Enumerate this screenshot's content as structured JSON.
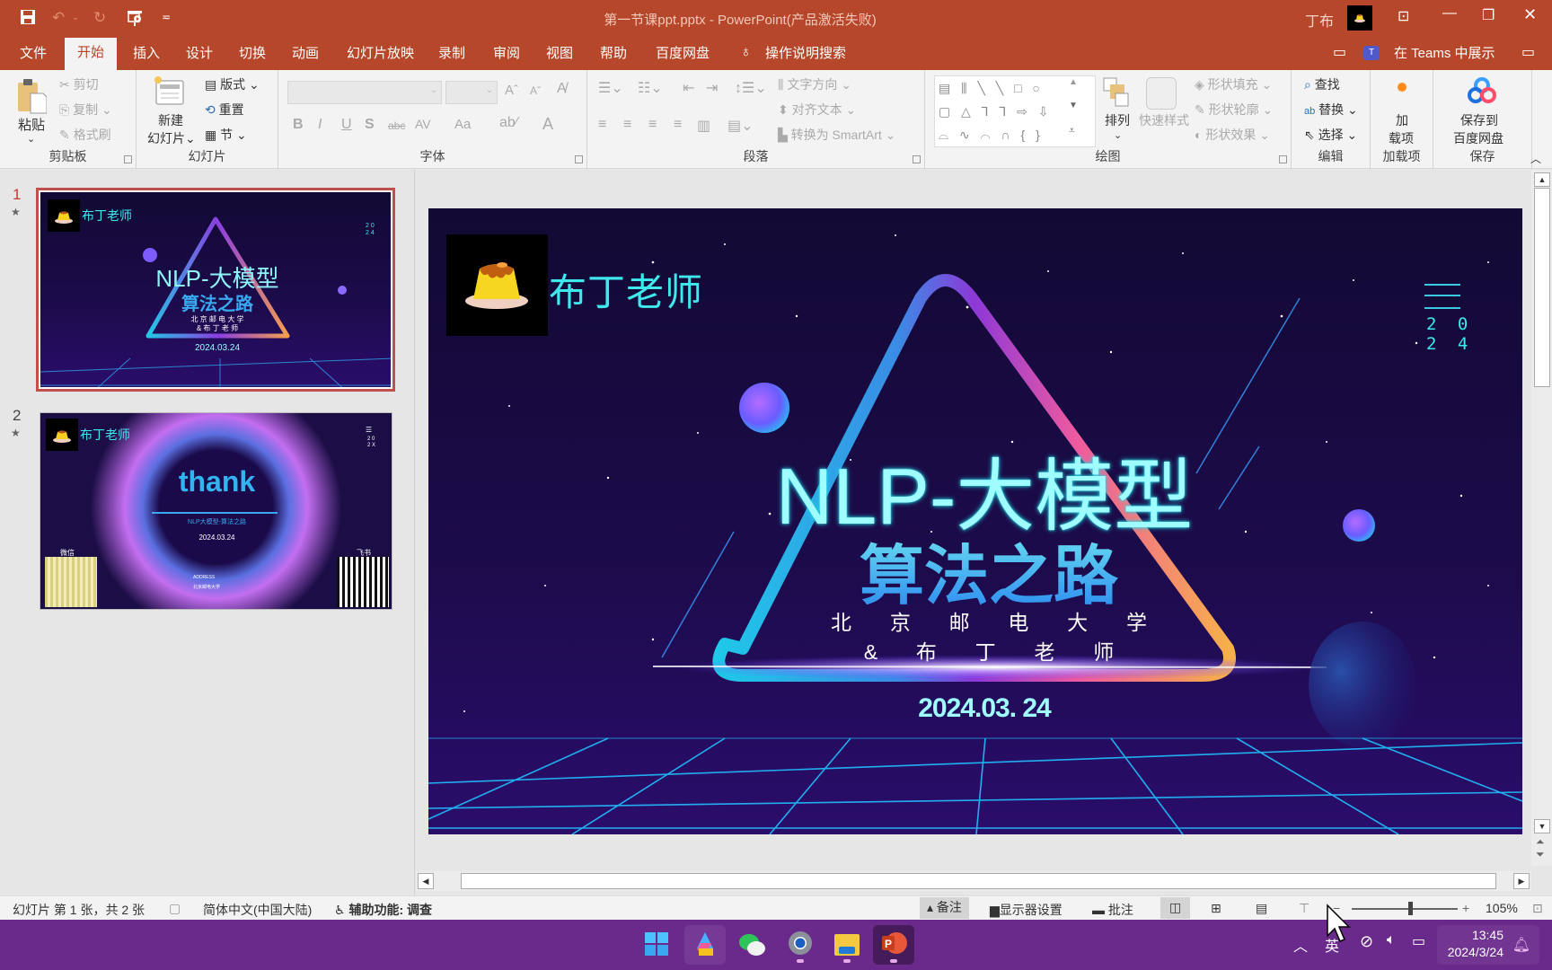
{
  "titlebar": {
    "doc_title": "第一节课ppt.pptx  -  PowerPoint(产品激活失败)",
    "user_name": "丁布",
    "quick_access": [
      "save-icon",
      "undo-icon",
      "redo-icon",
      "present-from-start-icon",
      "customize-qat-icon"
    ],
    "window_controls": [
      "ribbon-display-options",
      "minimize",
      "restore",
      "close"
    ]
  },
  "tabs": [
    {
      "label": "文件",
      "active": false
    },
    {
      "label": "开始",
      "active": true
    },
    {
      "label": "插入",
      "active": false
    },
    {
      "label": "设计",
      "active": false
    },
    {
      "label": "切换",
      "active": false
    },
    {
      "label": "动画",
      "active": false
    },
    {
      "label": "幻灯片放映",
      "active": false
    },
    {
      "label": "录制",
      "active": false
    },
    {
      "label": "审阅",
      "active": false
    },
    {
      "label": "视图",
      "active": false
    },
    {
      "label": "帮助",
      "active": false
    },
    {
      "label": "百度网盘",
      "active": false
    }
  ],
  "tell_me": "操作说明搜索",
  "teams_label": "在 Teams 中展示",
  "ribbon": {
    "clipboard": {
      "label": "剪贴板",
      "paste": "粘贴",
      "cut": "剪切",
      "copy": "复制",
      "format_painter": "格式刷"
    },
    "slides": {
      "label": "幻灯片",
      "new_slide_1": "新建",
      "new_slide_2": "幻灯片",
      "layout": "版式",
      "reset": "重置",
      "section": "节"
    },
    "font": {
      "label": "字体",
      "font_name": "",
      "font_size": "",
      "bold": "B",
      "italic": "I",
      "underline": "U",
      "shadow": "S",
      "strike": "abc",
      "spacing": "AV",
      "case": "Aa",
      "color": "A"
    },
    "paragraph": {
      "label": "段落",
      "text_direction": "文字方向",
      "align_text": "对齐文本",
      "smartart": "转换为 SmartArt"
    },
    "drawing": {
      "label": "绘图",
      "arrange": "排列",
      "quick_styles": "快速样式",
      "shape_fill": "形状填充",
      "shape_outline": "形状轮廓",
      "shape_effects": "形状效果"
    },
    "editing": {
      "label": "编辑",
      "find": "查找",
      "replace": "替换",
      "select": "选择"
    },
    "addins": {
      "label": "加载项",
      "btn_1": "加",
      "btn_2": "载项"
    },
    "save": {
      "label": "保存",
      "btn_1": "保存到",
      "btn_2": "百度网盘"
    }
  },
  "thumbnails": [
    {
      "number": "1",
      "selected": true,
      "brand": "布丁老师",
      "title": "NLP-大模型",
      "subtitle": "算法之路",
      "line1": "北 京 邮 电 大 学",
      "line2": "& 布 丁 老 师",
      "date": "2024.03.24",
      "year_top": "2 0",
      "year_bot": "2 4"
    },
    {
      "number": "2",
      "selected": false,
      "brand": "布丁老师",
      "title": "thank",
      "subtitle": "NLP大模型-算法之路",
      "date": "2024.03.24",
      "year_top": "2 0",
      "year_bot": "2 X",
      "left_label": "微信",
      "right_label": "飞书",
      "address_1": "ADDRESS",
      "address_2": "北京邮电大学"
    }
  ],
  "slide": {
    "brand": "布丁老师",
    "title": "NLP-大模型",
    "subtitle": "算法之路",
    "line1": "北  京  邮  电  大  学",
    "line2": "&  布  丁  老  师",
    "date": "2024.03. 24",
    "year_top": "2 0",
    "year_bot": "2 4"
  },
  "statusbar": {
    "slide_info": "幻灯片 第 1 张，共 2 张",
    "language": "简体中文(中国大陆)",
    "accessibility": "辅助功能: 调查",
    "notes": "备注",
    "display_settings": "显示器设置",
    "comments": "批注",
    "zoom_percent": "105%",
    "zoom_level": 0.55
  },
  "taskbar": {
    "apps": [
      "start",
      "pdf-editor",
      "wechat",
      "settings",
      "file-explorer",
      "powerpoint"
    ],
    "time": "13:45",
    "date": "2024/3/24",
    "ime": "英"
  },
  "colors": {
    "accent": "#b7472a",
    "taskbar": "#6a2a8c",
    "slide_cyan": "#3ee8ec"
  }
}
